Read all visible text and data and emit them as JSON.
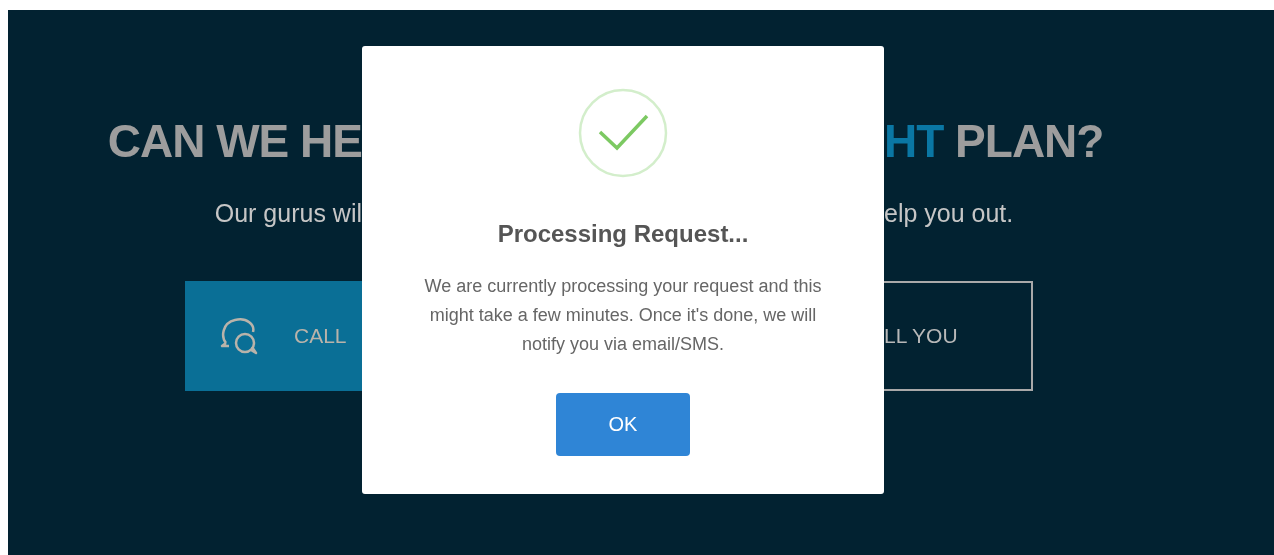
{
  "background": {
    "heading_left": [
      {
        "text": "CAN WE HE",
        "highlight": false
      }
    ],
    "heading_right": [
      {
        "text": "HT",
        "highlight": true
      },
      {
        "text": " PLAN?",
        "highlight": false
      }
    ],
    "subtitle_left": "Our gurus wil",
    "subtitle_right": "elp you out.",
    "button_left": {
      "label": "CALL",
      "kind": "filled"
    },
    "button_right": {
      "label": "LL YOU",
      "kind": "outlined"
    }
  },
  "dialog": {
    "title": "Processing Request...",
    "message": "We are currently processing your request and this might take a few minutes. Once it's done, we will notify you via email/SMS.",
    "button": "OK"
  }
}
